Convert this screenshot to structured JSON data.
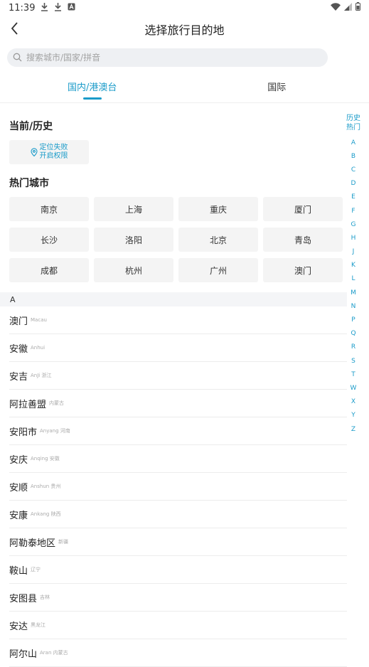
{
  "status_bar": {
    "time": "11:39"
  },
  "header": {
    "title": "选择旅行目的地"
  },
  "search": {
    "placeholder": "搜索城市/国家/拼音"
  },
  "tabs": [
    {
      "label": "国内/港澳台",
      "active": true
    },
    {
      "label": "国际",
      "active": false
    }
  ],
  "current": {
    "heading": "当前/历史",
    "locate_line1": "定位失败",
    "locate_line2": "开启权限"
  },
  "hot": {
    "heading": "热门城市",
    "cities": [
      "南京",
      "上海",
      "重庆",
      "厦门",
      "长沙",
      "洛阳",
      "北京",
      "青岛",
      "成都",
      "杭州",
      "广州",
      "澳门"
    ]
  },
  "section_letter": "A",
  "city_list": [
    {
      "name": "澳门",
      "sub": "Macau"
    },
    {
      "name": "安徽",
      "sub": "Anhui"
    },
    {
      "name": "安吉",
      "sub": "AnJi 浙江"
    },
    {
      "name": "阿拉善盟",
      "sub": "内蒙古"
    },
    {
      "name": "安阳市",
      "sub": "Anyang 河南"
    },
    {
      "name": "安庆",
      "sub": "Anqing 安徽"
    },
    {
      "name": "安顺",
      "sub": "Anshun 贵州"
    },
    {
      "name": "安康",
      "sub": "Ankang 陕西"
    },
    {
      "name": "阿勒泰地区",
      "sub": "新疆"
    },
    {
      "name": "鞍山",
      "sub": "辽宁"
    },
    {
      "name": "安图县",
      "sub": "吉林"
    },
    {
      "name": "安达",
      "sub": "黑龙江"
    },
    {
      "name": "阿尔山",
      "sub": "Aran 内蒙古"
    }
  ],
  "index_bar": {
    "hist1": "历史",
    "hist2": "热门",
    "letters": [
      "A",
      "B",
      "C",
      "D",
      "E",
      "F",
      "G",
      "H",
      "J",
      "K",
      "L",
      "M",
      "N",
      "P",
      "Q",
      "R",
      "S",
      "T",
      "W",
      "X",
      "Y",
      "Z"
    ]
  },
  "colors": {
    "accent": "#1a9bc9",
    "chip_bg": "#f4f4f4",
    "search_bg": "#eef0f3"
  }
}
